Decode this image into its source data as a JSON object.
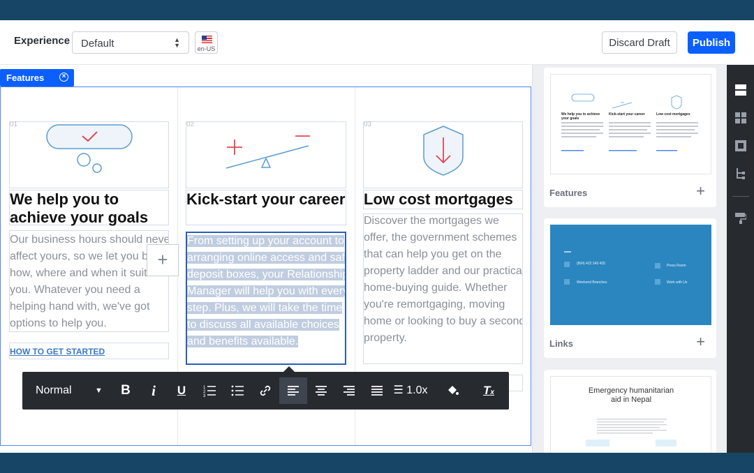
{
  "header": {
    "experience_label": "Experience",
    "experience_value": "Default",
    "locale_code": "en-US",
    "discard_label": "Discard Draft",
    "publish_label": "Publish"
  },
  "fragment": {
    "tag_label": "Features",
    "columns": [
      {
        "num": "01",
        "title": "We help you to achieve your goals",
        "body": "Our business hours should never affect yours, so we let you bank how, where and when it suits you. Whatever you need a helping hand with, we've got options to help you.",
        "link": "HOW TO GET STARTED"
      },
      {
        "num": "02",
        "title": "Kick-start your career",
        "body": "From setting up your account to arranging online access and safe deposit boxes, your Relationship Manager will help you with every step. Plus, we will take the time to discuss all available choices and benefits available."
      },
      {
        "num": "03",
        "title": "Low cost mortgages",
        "body": "Discover the mortgages we offer, the government schemes that can help you get on the property ladder and our practical home-buying guide. Whether you're remortgaging, moving home or looking to buy a second property."
      }
    ]
  },
  "toolbar": {
    "style": "Normal",
    "bold": "B",
    "italic": "i",
    "underline": "U",
    "line_height": "1.0x",
    "clear_format": "T"
  },
  "panel": {
    "cards": [
      {
        "label": "Features"
      },
      {
        "label": "Links"
      },
      {
        "label": "",
        "preview_title": "Emergency humanitarian aid in Nepal"
      }
    ],
    "thumb_features": {
      "titles": [
        "We help you to achieve your goals",
        "Kick-start your career",
        "Low cost mortgages"
      ]
    },
    "thumb_links": {
      "rows": [
        "(804) 422 343 435",
        "Press Room",
        "Weekend Branches",
        "Work with Us"
      ]
    }
  },
  "colors": {
    "accent": "#0b5fff",
    "frame_bg": "#164566",
    "toolbar_bg": "#272b30",
    "links_thumb_bg": "#2b86c0",
    "icon_red": "#e0474f",
    "icon_blue": "#5a9ccf"
  }
}
